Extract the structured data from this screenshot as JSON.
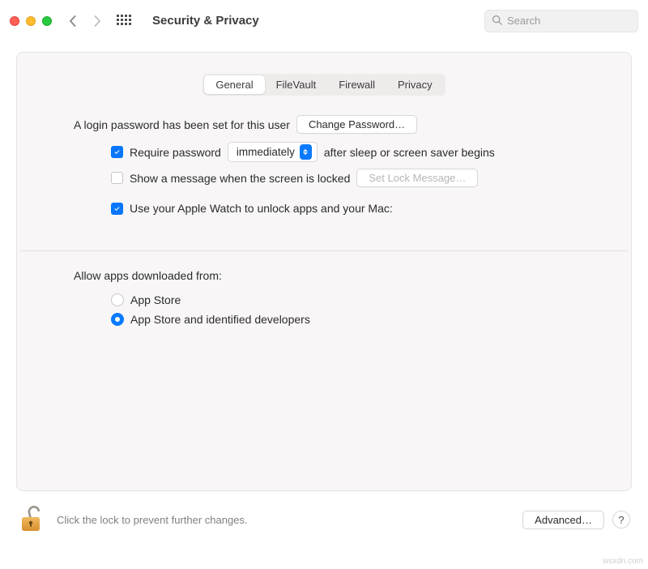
{
  "header": {
    "title": "Security & Privacy",
    "search_placeholder": "Search"
  },
  "tabs": {
    "items": [
      "General",
      "FileVault",
      "Firewall",
      "Privacy"
    ],
    "active": 0
  },
  "general": {
    "password_set_text": "A login password has been set for this user",
    "change_password_label": "Change Password…",
    "require_password_label": "Require password",
    "delay_value": "immediately",
    "after_sleep_text": "after sleep or screen saver begins",
    "show_message_label": "Show a message when the screen is locked",
    "set_lock_message_label": "Set Lock Message…",
    "apple_watch_label": "Use your Apple Watch to unlock apps and your Mac:"
  },
  "download": {
    "heading": "Allow apps downloaded from:",
    "option_appstore": "App Store",
    "option_identified": "App Store and identified developers"
  },
  "footer": {
    "lock_text": "Click the lock to prevent further changes.",
    "advanced_label": "Advanced…",
    "help_label": "?"
  },
  "watermark": "wsxdn.com"
}
